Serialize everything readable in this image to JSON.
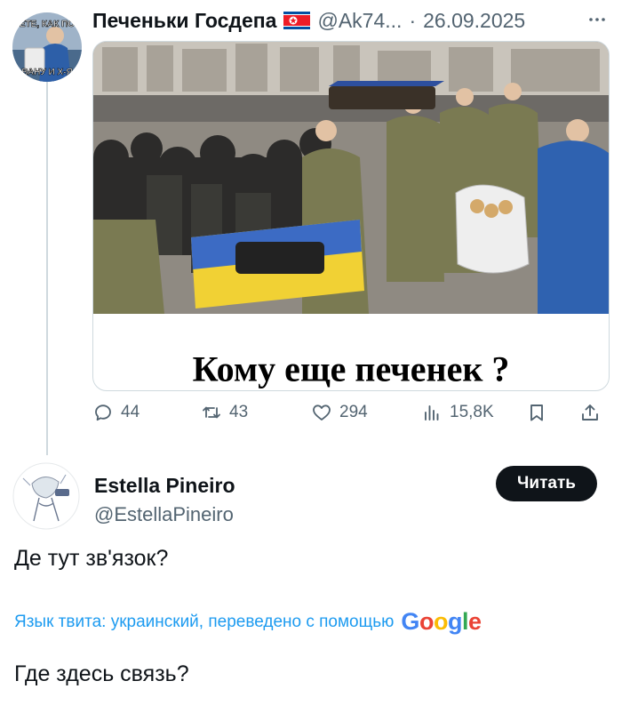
{
  "tweet": {
    "author_name": "Печеньки Госдепа",
    "flag_icon": "north-korea-flag-icon",
    "handle": "@Ak74...",
    "separator": "·",
    "date": "26.09.2025",
    "media": {
      "caption": "Кому еще печенек ?",
      "avatar_text_top": "ЕТЕ, КАК ПО",
      "avatar_text_bottom": "ВАНУ И Х-Я"
    },
    "actions": {
      "replies": "44",
      "reposts": "43",
      "likes": "294",
      "views": "15,8K"
    }
  },
  "reply": {
    "author_name": "Estella Pineiro",
    "handle": "@EstellaPineiro",
    "follow_label": "Читать",
    "text": "Де тут зв'язок?",
    "translation_note": "Язык твита: украинский, переведено с помощью",
    "translation_provider": "Google",
    "translated_text": "Где здесь связь?"
  },
  "colors": {
    "text": "#0f1419",
    "secondary": "#536471",
    "link": "#1d9bf0",
    "border": "#cfd9de",
    "google_blue": "#4285F4",
    "google_red": "#EA4335",
    "google_yellow": "#FBBC05",
    "google_green": "#34A853"
  }
}
